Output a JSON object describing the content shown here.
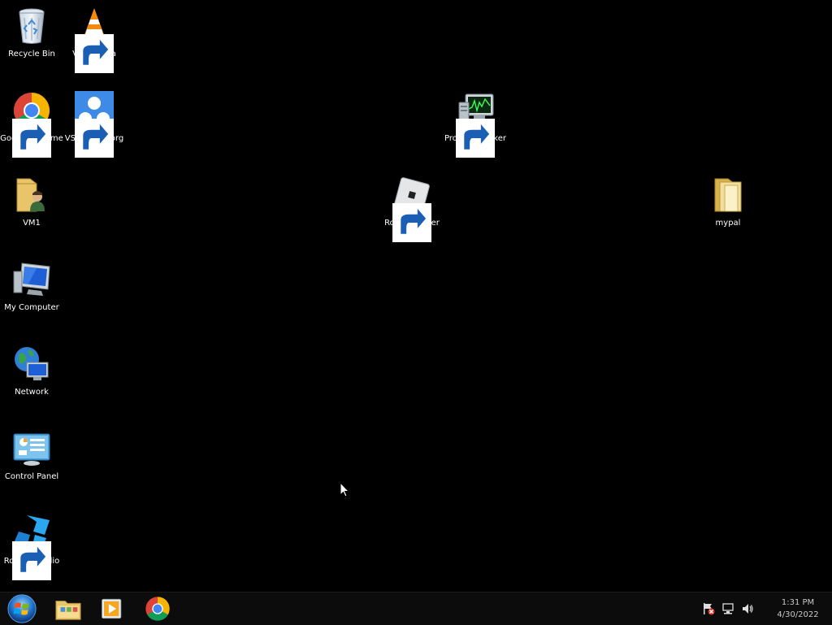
{
  "desktop": {
    "icons": [
      {
        "label": "Recycle Bin",
        "icon": "recycle-bin-icon"
      },
      {
        "label": "VLC media player",
        "icon": "vlc-icon"
      },
      {
        "label": "Google Chrome",
        "icon": "chrome-icon"
      },
      {
        "label": "VSThemes.org",
        "icon": "vsthemes-icon"
      },
      {
        "label": "Process Hacker 2",
        "icon": "process-hacker-icon"
      },
      {
        "label": "VM1",
        "icon": "user-folder-icon"
      },
      {
        "label": "Roblox Player",
        "icon": "roblox-player-icon"
      },
      {
        "label": "mypal",
        "icon": "folder-icon"
      },
      {
        "label": "My Computer",
        "icon": "computer-icon"
      },
      {
        "label": "Network",
        "icon": "network-icon"
      },
      {
        "label": "Control Panel",
        "icon": "control-panel-icon"
      },
      {
        "label": "Roblox Studio",
        "icon": "roblox-studio-icon"
      }
    ]
  },
  "taskbar": {
    "pinned": [
      {
        "icon": "windows-explorer-icon"
      },
      {
        "icon": "media-player-icon"
      },
      {
        "icon": "chrome-icon"
      }
    ],
    "tray": {
      "icons": [
        "action-center-flag-icon",
        "network-tray-icon",
        "volume-icon"
      ],
      "time": "1:31 PM",
      "date": "4/30/2022"
    }
  },
  "colors": {
    "desktop_background": "#000000",
    "taskbar_background": "#0c0c0c",
    "label_text": "#ffffff"
  }
}
